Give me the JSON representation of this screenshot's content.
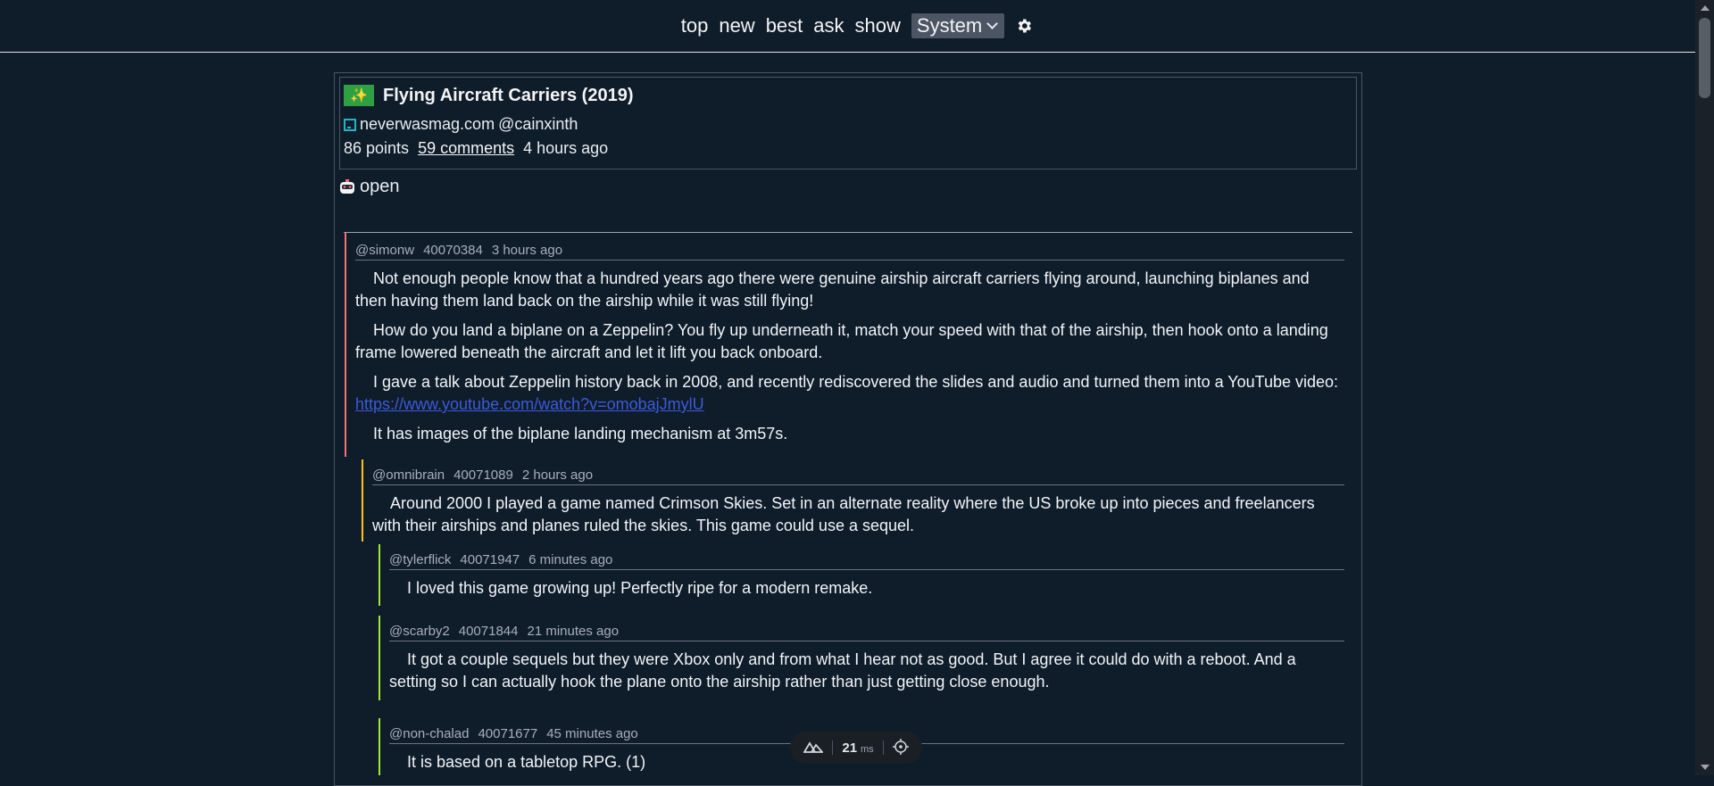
{
  "nav": {
    "links": [
      "top",
      "new",
      "best",
      "ask",
      "show"
    ],
    "theme": "System"
  },
  "story": {
    "title": "Flying Aircraft Carriers (2019)",
    "domain": "neverwasmag.com",
    "author": "@cainxinth",
    "points": "86 points",
    "comments": "59 comments",
    "time": "4 hours ago",
    "open_label": "open"
  },
  "comments": [
    {
      "user": "@simonw",
      "id": "40070384",
      "time": "3 hours ago",
      "color": "#f87171",
      "paragraphs": [
        "Not enough people know that a hundred years ago there were genuine airship aircraft carriers flying around, launching biplanes and then having them land back on the airship while it was still flying!",
        "How do you land a biplane on a Zeppelin? You fly up underneath it, match your speed with that of the airship, then hook onto a landing frame lowered beneath the aircraft and let it lift you back onboard.",
        "I gave a talk about Zeppelin history back in 2008, and recently rediscovered the slides and audio and turned them into a YouTube video: ",
        "It has images of the biplane landing mechanism at 3m57s."
      ],
      "link": "https://www.youtube.com/watch?v=omobajJmylU"
    },
    {
      "user": "@omnibrain",
      "id": "40071089",
      "time": "2 hours ago",
      "color": "#fbbf24",
      "paragraphs": [
        "Around 2000 I played a game named Crimson Skies. Set in an alternate reality where the US broke up into pieces and freelancers with their airships and planes ruled the skies. This game could use a sequel."
      ]
    },
    {
      "user": "@tylerflick",
      "id": "40071947",
      "time": "6 minutes ago",
      "color": "#a3e635",
      "paragraphs": [
        "I loved this game growing up! Perfectly ripe for a modern remake."
      ]
    },
    {
      "user": "@scarby2",
      "id": "40071844",
      "time": "21 minutes ago",
      "color": "#a3e635",
      "paragraphs": [
        "It got a couple sequels but they were Xbox only and from what I hear not as good. But I agree it could do with a reboot. And a setting so I can actually hook the plane onto the airship rather than just getting close enough."
      ]
    },
    {
      "user": "@non-chalad",
      "id": "40071677",
      "time": "45 minutes ago",
      "color": "#a3e635",
      "paragraphs": [
        "It is based on a tabletop RPG. (1)"
      ]
    }
  ],
  "perf": {
    "value": "21",
    "unit": "ms"
  },
  "icons": {
    "settings": "gear-icon",
    "story": "sparkle-icon",
    "favicon": "site-favicon",
    "open": "robot-icon",
    "perf_logo": "nuxt-logo-icon",
    "locate": "crosshair-icon"
  }
}
